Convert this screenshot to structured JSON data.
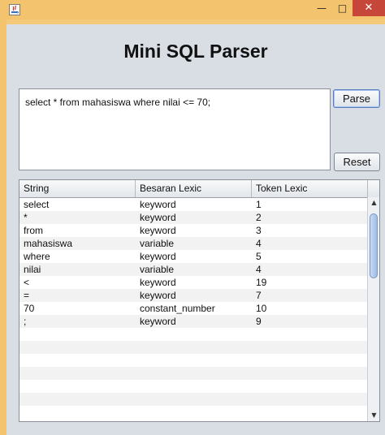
{
  "window": {
    "minimize_glyph": "—",
    "maximize_glyph": "□",
    "close_glyph": "✕"
  },
  "app": {
    "title": "Mini SQL Parser"
  },
  "query": {
    "value": "select * from mahasiswa where nilai <= 70;"
  },
  "buttons": {
    "parse": "Parse",
    "reset": "Reset"
  },
  "table": {
    "columns": [
      "String",
      "Besaran Lexic",
      "Token Lexic"
    ],
    "rows": [
      [
        "select",
        "keyword",
        "1"
      ],
      [
        "*",
        "keyword",
        "2"
      ],
      [
        "from",
        "keyword",
        "3"
      ],
      [
        "mahasiswa",
        "variable",
        "4"
      ],
      [
        "where",
        "keyword",
        "5"
      ],
      [
        "nilai",
        "variable",
        "4"
      ],
      [
        "<",
        "keyword",
        "19"
      ],
      [
        "=",
        "keyword",
        "7"
      ],
      [
        "70",
        "constant_number",
        "10"
      ],
      [
        ";",
        "keyword",
        "9"
      ]
    ],
    "empty_rows": 7,
    "scroll_up_glyph": "▲",
    "scroll_down_glyph": "▼"
  }
}
